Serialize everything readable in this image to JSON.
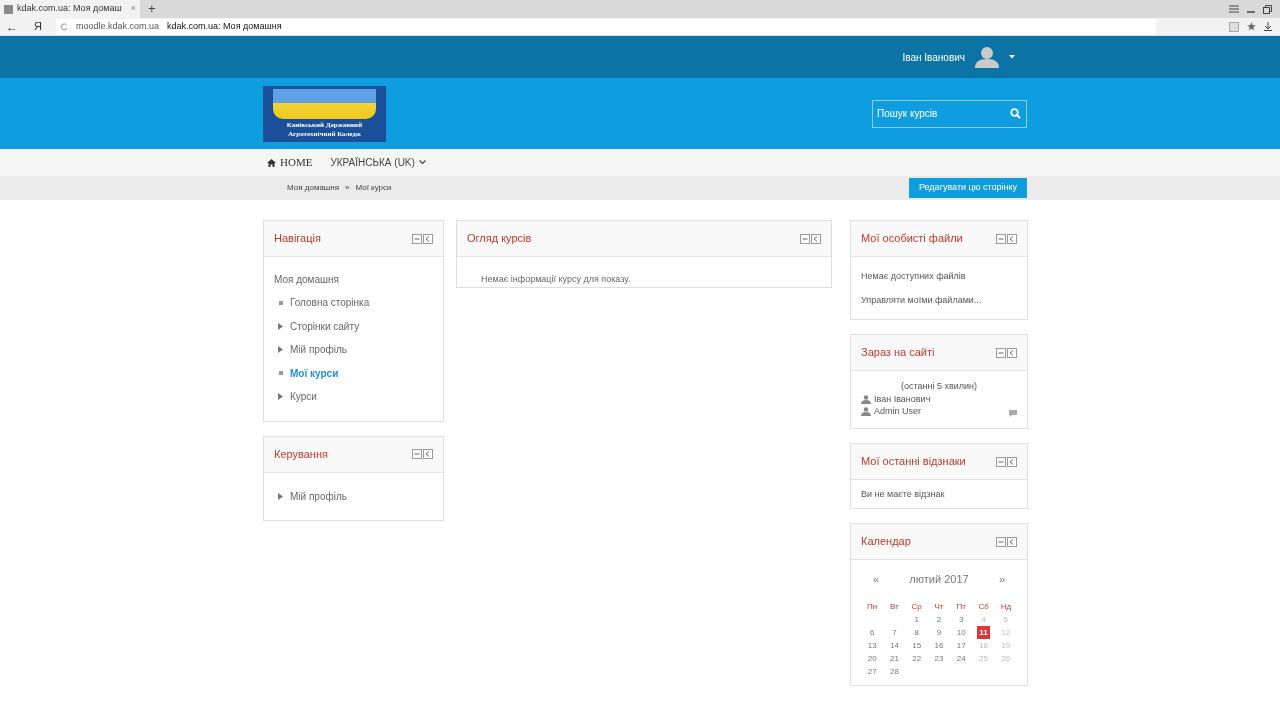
{
  "browser": {
    "tab_title": "kdak.com.ua: Моя домаш",
    "tab_close": "×",
    "new_tab": "+",
    "back": "←",
    "yandex": "Я",
    "url_host": "moodle.kdak.com.ua",
    "url_title": "kdak.com.ua: Моя домашня"
  },
  "top_bar": {
    "user_name": "Іван Іванович"
  },
  "header": {
    "logo_lines": [
      "Канівський Державний",
      "Агротехнічний Коледж"
    ],
    "search": {
      "placeholder": "Пошук курсів"
    }
  },
  "nav_bar": {
    "home": "HOME",
    "language": "УКРАЇНСЬКА (UK)"
  },
  "breadcrumb": {
    "items": [
      "Моя домашня",
      "Мої курси"
    ],
    "separator": "»",
    "edit_button": "Редагувати цю сторінку"
  },
  "left_blocks": [
    {
      "title": "Навігація",
      "root": "Моя домашня",
      "items": [
        {
          "label": "Головна сторінка",
          "kind": "leaf",
          "selected": false
        },
        {
          "label": "Сторінки сайту",
          "kind": "branch",
          "selected": false
        },
        {
          "label": "Мій профіль",
          "kind": "branch",
          "selected": false
        },
        {
          "label": "Мої курси",
          "kind": "leaf",
          "selected": true
        },
        {
          "label": "Курси",
          "kind": "branch",
          "selected": false
        }
      ]
    },
    {
      "title": "Керування",
      "items": [
        {
          "label": "Мій профіль",
          "kind": "branch",
          "selected": false
        }
      ]
    }
  ],
  "center_block": {
    "title": "Огляд курсів",
    "message": "Немає інформації курсу для показу."
  },
  "right_blocks": {
    "files": {
      "title": "Мої особисті файли",
      "lines": [
        "Немає доступних файлів",
        "Управляти моїми файлами..."
      ]
    },
    "online": {
      "title": "Зараз на сайті",
      "period": "(останні 5 хвилин)",
      "users": [
        {
          "name": "Іван Іванович",
          "message_icon": false
        },
        {
          "name": "Admin User",
          "message_icon": true
        }
      ]
    },
    "badges": {
      "title": "Мої останні відзнаки",
      "message": "Ви не маєте відзнак"
    },
    "calendar": {
      "title": "Календар",
      "prev": "«",
      "month": "лютий 2017",
      "next": "»",
      "weekdays": [
        "Пн",
        "Вт",
        "Ср",
        "Чт",
        "Пт",
        "Сб",
        "Нд"
      ],
      "weeks": [
        [
          {
            "day": "1",
            "weekend": false,
            "today": false
          },
          {
            "day": "2",
            "weekend": false,
            "today": false
          },
          {
            "day": "3",
            "weekend": false,
            "today": false
          },
          {
            "day": "4",
            "weekend": true,
            "today": false
          },
          {
            "day": "5",
            "weekend": true,
            "today": false
          }
        ],
        [
          {
            "day": "6",
            "weekend": false,
            "today": false
          },
          {
            "day": "7",
            "weekend": false,
            "today": false
          },
          {
            "day": "8",
            "weekend": false,
            "today": false
          },
          {
            "day": "9",
            "weekend": false,
            "today": false
          },
          {
            "day": "10",
            "weekend": false,
            "today": false
          },
          {
            "day": "11",
            "weekend": true,
            "today": true
          },
          {
            "day": "12",
            "weekend": true,
            "today": false
          }
        ],
        [
          {
            "day": "13",
            "weekend": false,
            "today": false
          },
          {
            "day": "14",
            "weekend": false,
            "today": false
          },
          {
            "day": "15",
            "weekend": false,
            "today": false
          },
          {
            "day": "16",
            "weekend": false,
            "today": false
          },
          {
            "day": "17",
            "weekend": false,
            "today": false
          },
          {
            "day": "18",
            "weekend": true,
            "today": false
          },
          {
            "day": "19",
            "weekend": true,
            "today": false
          }
        ],
        [
          {
            "day": "20",
            "weekend": false,
            "today": false
          },
          {
            "day": "21",
            "weekend": false,
            "today": false
          },
          {
            "day": "22",
            "weekend": false,
            "today": false
          },
          {
            "day": "23",
            "weekend": false,
            "today": false
          },
          {
            "day": "24",
            "weekend": false,
            "today": false
          },
          {
            "day": "25",
            "weekend": true,
            "today": false
          },
          {
            "day": "26",
            "weekend": true,
            "today": false
          }
        ],
        [
          {
            "day": "27",
            "weekend": false,
            "today": false
          },
          {
            "day": "28",
            "weekend": false,
            "today": false
          }
        ]
      ]
    }
  }
}
